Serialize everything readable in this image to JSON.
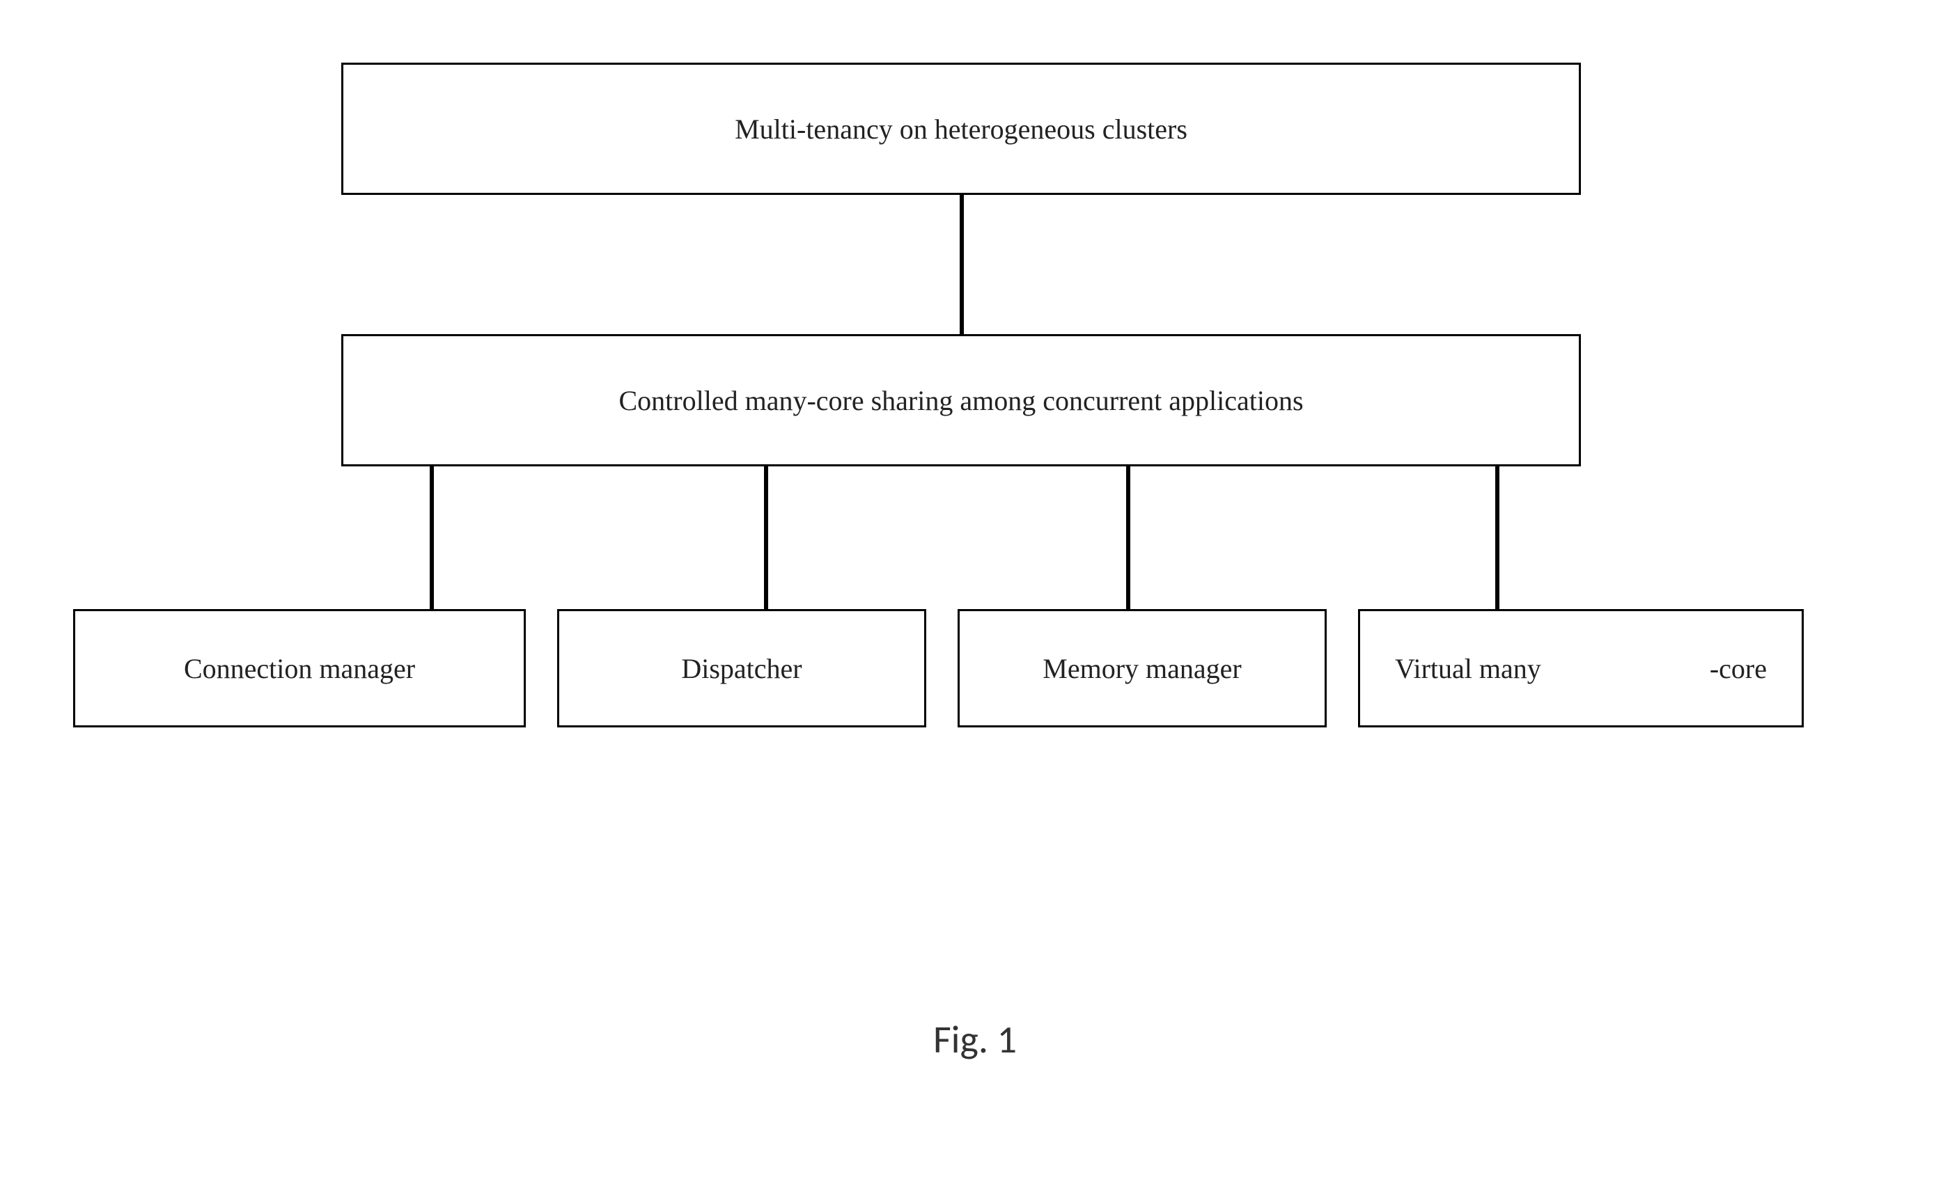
{
  "diagram": {
    "top_box": "Multi-tenancy on heterogeneous clusters",
    "middle_box": "Controlled many-core sharing among concurrent applications",
    "bottom_boxes": {
      "b1": "Connection manager",
      "b2": "Dispatcher",
      "b3": "Memory manager",
      "b4_part1": "Virtual many",
      "b4_part2": "-core"
    }
  },
  "caption": "Fig. 1"
}
